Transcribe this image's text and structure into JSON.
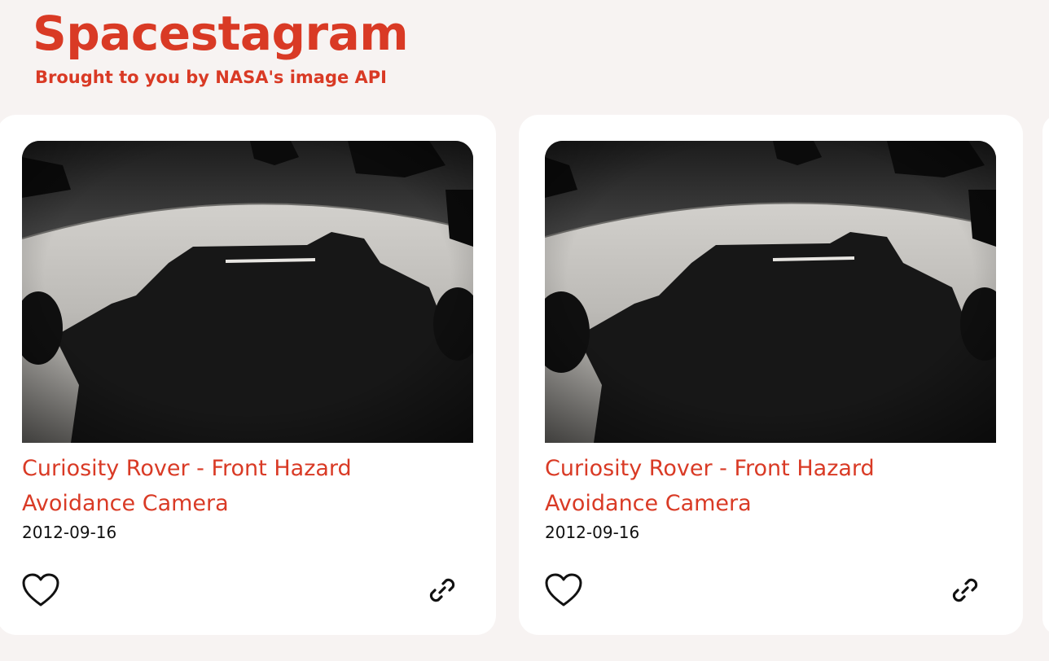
{
  "header": {
    "title": "Spacestagram",
    "subtitle": "Brought to you by NASA's image API"
  },
  "cards": [
    {
      "title": "Curiosity Rover - Front Hazard Avoidance Camera",
      "date": "2012-09-16",
      "liked": false,
      "like_icon": "heart-outline-icon",
      "link_icon": "link-icon"
    },
    {
      "title": "Curiosity Rover - Front Hazard Avoidance Camera",
      "date": "2012-09-16",
      "liked": false,
      "like_icon": "heart-outline-icon",
      "link_icon": "link-icon"
    }
  ],
  "colors": {
    "accent": "#d93a25",
    "background": "#f7f3f2",
    "card": "#ffffff"
  }
}
